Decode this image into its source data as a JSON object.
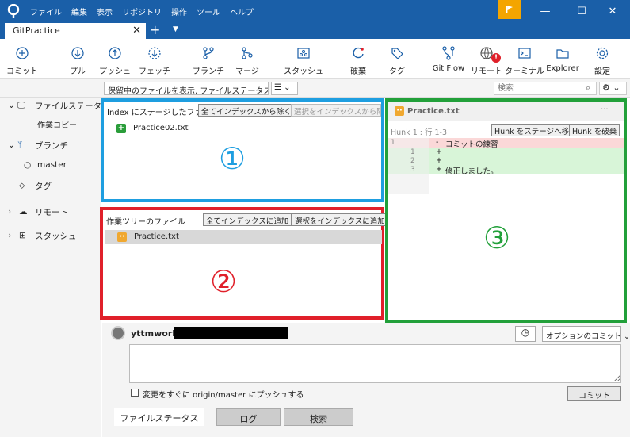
{
  "menu": [
    "ファイル",
    "編集",
    "表示",
    "リポジトリ",
    "操作",
    "ツール",
    "ヘルプ"
  ],
  "tab": {
    "title": "GitPractice"
  },
  "toolbar": [
    {
      "label": "コミット",
      "icon": "commit-icon"
    },
    {
      "label": "プル",
      "icon": "pull-icon"
    },
    {
      "label": "プッシュ",
      "icon": "push-icon"
    },
    {
      "label": "フェッチ",
      "icon": "fetch-icon"
    },
    {
      "label": "ブランチ",
      "icon": "branch-icon"
    },
    {
      "label": "マージ",
      "icon": "merge-icon"
    },
    {
      "label": "スタッシュ",
      "icon": "stash-icon"
    },
    {
      "label": "破棄",
      "icon": "discard-icon"
    },
    {
      "label": "タグ",
      "icon": "tag-icon"
    },
    {
      "label": "Git Flow",
      "icon": "git-flow-icon"
    },
    {
      "label": "リモート",
      "icon": "remote-icon"
    },
    {
      "label": "ターミナル",
      "icon": "terminal-icon"
    },
    {
      "label": "Explorer",
      "icon": "explorer-icon"
    },
    {
      "label": "設定",
      "icon": "settings-icon"
    }
  ],
  "filter": {
    "label": "保留中のファイルを表示, ファイルステータス順",
    "search_placeholder": "検索"
  },
  "sidebar": {
    "file_status": "ファイルステータス",
    "working_copy": "作業コピー",
    "branches": "ブランチ",
    "master": "master",
    "tags": "タグ",
    "remotes": "リモート",
    "stashes": "スタッシュ"
  },
  "staged": {
    "title": "Index にステージしたファイル",
    "unstage_all": "全てインデックスから除く",
    "unstage_selected": "選択をインデックスから除く",
    "files": [
      "Practice02.txt"
    ],
    "marker": "①"
  },
  "unstaged": {
    "title": "作業ツリーのファイル",
    "stage_all": "全てインデックスに追加",
    "stage_selected": "選択をインデックスに追加",
    "files": [
      "Practice.txt"
    ],
    "marker": "②"
  },
  "diff": {
    "filename": "Practice.txt",
    "menu": "···",
    "hunk_label": "Hunk 1 : 行 1-3",
    "stage_hunk": "Hunk をステージへ移動",
    "discard_hunk": "Hunk を破棄",
    "lines": [
      {
        "old": "1",
        "new": "",
        "sign": "-",
        "text": "コミットの練習",
        "kind": "del"
      },
      {
        "old": "",
        "new": "1",
        "sign": "+",
        "text": "",
        "kind": "add"
      },
      {
        "old": "",
        "new": "2",
        "sign": "+",
        "text": "",
        "kind": "add"
      },
      {
        "old": "",
        "new": "3",
        "sign": "+",
        "text": "修正しました。",
        "kind": "add"
      }
    ],
    "marker": "③"
  },
  "commit": {
    "user": "yttmwork",
    "options": "オプションのコミット",
    "push_checkbox": "変更をすぐに origin/master にプッシュする",
    "commit_button": "コミット"
  },
  "bottom_tabs": [
    "ファイルステータス",
    "ログ",
    "検索"
  ],
  "colors": {
    "titlebar": "#1a5fa8",
    "panel1": "#1e9ee0",
    "panel2": "#e0202a",
    "panel3": "#22a03a",
    "flag": "#f4a500"
  }
}
